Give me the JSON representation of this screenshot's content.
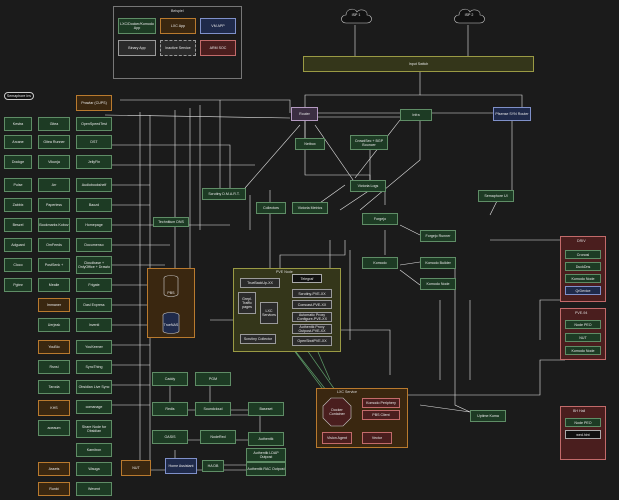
{
  "legend": {
    "title": "Beispiel",
    "items": [
      "LXC/Docker/Komodo App",
      "LXC App",
      "VM APP",
      "Binary App",
      "Inactive Service",
      "ARM SOC"
    ]
  },
  "clouds": [
    "ISP 1",
    "ISP 2"
  ],
  "input_switch": "Input Switch",
  "core": {
    "router": "Router",
    "pfsense": "Pfsense SYN Router",
    "netbox": "Netbox",
    "infra": "Infra",
    "crowdsec": "CrowdSec + BGP Bouncer",
    "victoria_logs": "Victoria Logs",
    "victoria_metrics": "Victoria Metrics",
    "collectors": "Collectors",
    "forgejo": "Forgejo",
    "forgejo_runner": "Forgejo Runner",
    "komodo": "Komodo",
    "komodo_builder": "Komodo Builder",
    "komodo_node": "Komodo Node",
    "semaphore": "Semaphore UI",
    "scrutiny": "Scrutiny D.M.A.R.T.",
    "technitium": "Technitium DNS",
    "pbs": "PBS",
    "truenas": "TrueNAS"
  },
  "left_column": [
    "Kestra",
    "Arcane",
    "Dockge",
    "Pulse",
    "Zabbix",
    "Beszel",
    "Adguard",
    "Cloco",
    "Pgbnr"
  ],
  "middle_column": [
    "Gitea",
    "Gitea Runner",
    "Vikunja",
    "Arr",
    "Paperless",
    "Bookmarks Kobov",
    "OmFeeds",
    "PostSenk +",
    "Mealie"
  ],
  "right_column": [
    "Prowlar (CUPS)",
    "OpenSpeedTest",
    "DST",
    "JellyFin",
    "Audiobookshelf",
    "Baozd",
    "Homepage",
    "Documenso",
    "Cloudbase + OnlyOffice + Drawio",
    "Frigate"
  ],
  "lower_left": [
    "Immaner",
    "Uerjeak",
    "YouBio",
    "Rsnsi",
    "Taroda",
    "KHS",
    "aoeaum"
  ],
  "lower_mid": [
    "Dasl Express",
    "Inventi",
    "YouKeener",
    "SyncThing",
    "Obsidian Live Sync",
    "comanage",
    "Share Node for Obsidian",
    "Karnitron"
  ],
  "bottom_left": [
    "Assets",
    "Runkt"
  ],
  "bottom_mid": [
    "Wauga",
    "Wevent"
  ],
  "pve_node": {
    "title": "PVE Node",
    "nodes": [
      "TrueBackUp-XX",
      "Telegraf",
      "Grepl. Traffic pages",
      "Scrutiny-PVE-XX",
      "Comcast-PVE-XX",
      "LXC Services",
      "Automatic Proxy Configure-PVE-XX",
      "Authentik Proxy Outpost-PVE-XX",
      "Scrutiny Collector",
      "OpenSbotPVE-XX"
    ]
  },
  "lower_services": [
    "Caddy",
    "PGM",
    "Redis",
    "Soundcloud",
    "Baseset",
    "OASIS",
    "NodeRed",
    "Authentik",
    "Authentik LDAP Outpost",
    "Authentik RAC Outpost",
    "Home Assistant",
    "HA DB",
    "NUT"
  ],
  "lxc_services": {
    "title": "LXC Service",
    "docker": "Docker Container",
    "nodes": [
      "Komodo Periphery",
      "PBS Client",
      "Vision Agent",
      "Vector"
    ]
  },
  "uptime_kuma": "Uptime Kuma",
  "right_panels": [
    {
      "title": "DRIV",
      "items": [
        "Cronosl",
        "DuckDns",
        "Komodo Node",
        "QrDevice"
      ]
    },
    {
      "title": "PVE-94",
      "items": [
        "Node PEO",
        "NUT",
        "Komodo Node"
      ]
    },
    {
      "title": "BH Hall",
      "items": [
        "Node PEO",
        "wed.hint"
      ]
    }
  ],
  "pill": "Semaphore Inv",
  "colors": {
    "green": "#1d3b24",
    "orange": "#3a2710",
    "olive": "#34361a",
    "purple": "#3b2e42",
    "blue": "#1f2a4a",
    "red": "#4a1e1e"
  }
}
